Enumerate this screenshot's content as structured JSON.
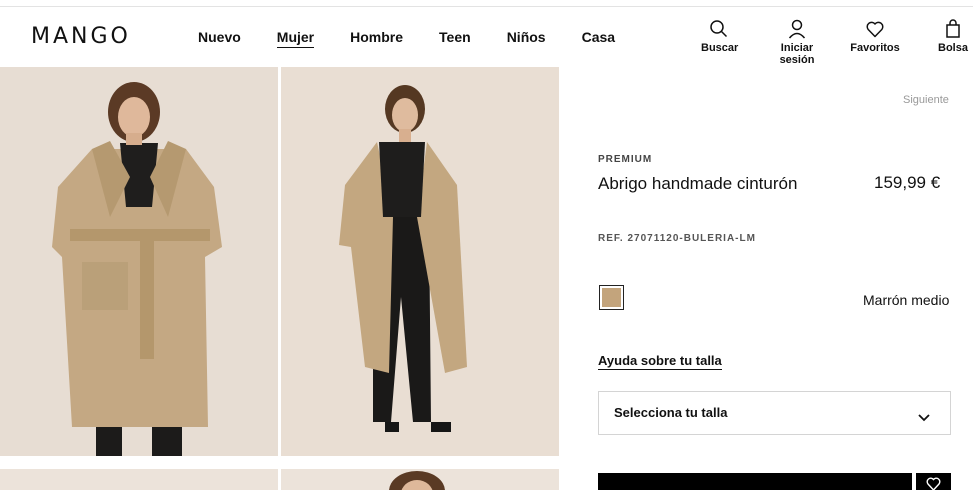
{
  "header": {
    "logo": "MANGO",
    "nav": [
      "Nuevo",
      "Mujer",
      "Hombre",
      "Teen",
      "Niños",
      "Casa"
    ],
    "active_nav": "Mujer",
    "tools": {
      "search": "Buscar",
      "login": "Iniciar sesión",
      "favorites": "Favoritos",
      "bag": "Bolsa"
    }
  },
  "product": {
    "next_label": "Siguiente",
    "brand_line": "PREMIUM",
    "name": "Abrigo handmade cinturón",
    "price": "159,99 €",
    "ref": "REF. 27071120-BULERIA-LM",
    "color_name": "Marrón medio",
    "color_hex": "#c3a47c",
    "size_help": "Ayuda sobre tu talla",
    "size_select_placeholder": "Selecciona tu talla"
  },
  "icons": {
    "search": "search-icon",
    "user": "user-icon",
    "heart": "heart-icon",
    "bag": "bag-icon",
    "chevron": "chevron-down-icon"
  }
}
